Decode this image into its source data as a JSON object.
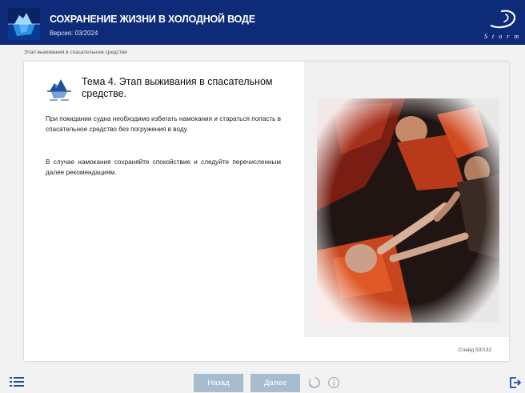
{
  "header": {
    "title": "СОХРАНЕНИЕ ЖИЗНИ В ХОЛОДНОЙ ВОДЕ",
    "version": "Версия: 03/2024",
    "brand_text": "Storm"
  },
  "breadcrumb": "Этап выживания в спасательном средстве",
  "content": {
    "topic_title": "Тема 4. Этап выживания в спасательном средстве.",
    "paragraph_1": "При покидании судна необходимо избегать намокания и стараться попасть в спасательное средство без погружения в воду.",
    "paragraph_2": "В случае намокания сохраняйте спокойствие и следуйте перечисленным далее рекомендациям.",
    "slide_counter": "Слайд 53/132"
  },
  "footer": {
    "back_label": "Назад",
    "next_label": "Далее"
  },
  "icons": {
    "logo": "iceberg-logo-icon",
    "brand": "storm-logo-icon",
    "topic": "iceberg-icon",
    "menu": "menu-list-icon",
    "reload": "reload-icon",
    "info": "info-icon",
    "exit": "exit-icon"
  },
  "colors": {
    "header_bg": "#0e2b7a",
    "button_bg": "#a6bdd0",
    "icon_blue": "#1d4f9a"
  }
}
